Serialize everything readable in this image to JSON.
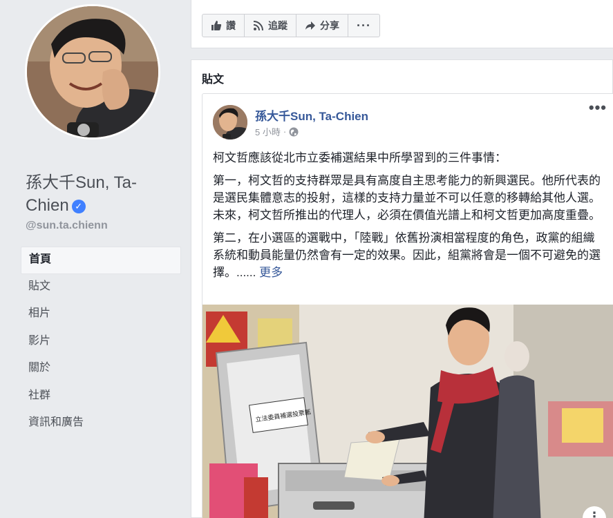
{
  "profile": {
    "name": "孫大千Sun, Ta-Chien",
    "handle": "@sun.ta.chienn"
  },
  "nav": {
    "items": [
      {
        "label": "首頁",
        "active": true
      },
      {
        "label": "貼文"
      },
      {
        "label": "相片"
      },
      {
        "label": "影片"
      },
      {
        "label": "關於"
      },
      {
        "label": "社群"
      },
      {
        "label": "資訊和廣告"
      }
    ]
  },
  "actions": {
    "like_label": "讚",
    "follow_label": "追蹤",
    "share_label": "分享",
    "more_label": "···"
  },
  "posts": {
    "title": "貼文",
    "post": {
      "author": "孫大千Sun, Ta-Chien",
      "time": "5 小時",
      "paragraphs": [
        "柯文哲應該從北市立委補選結果中所學習到的三件事情：",
        "第一，柯文哲的支持群眾是具有高度自主思考能力的新興選民。他所代表的是選民集體意志的投射，這樣的支持力量並不可以任意的移轉給其他人選。未來，柯文哲所推出的代理人，必須在價值光譜上和柯文哲更加高度重疊。",
        "第二，在小選區的選戰中，「陸戰」依舊扮演相當程度的角色，政黨的組織系統和動員能量仍然會有一定的效果。因此，組黨將會是一個不可避免的選擇。......"
      ],
      "more_link": "更多",
      "ballot_box_label": "立法委員補選投票匭"
    }
  },
  "colors": {
    "link": "#365899",
    "background": "#e9ebee",
    "verified": "#4080ff"
  }
}
